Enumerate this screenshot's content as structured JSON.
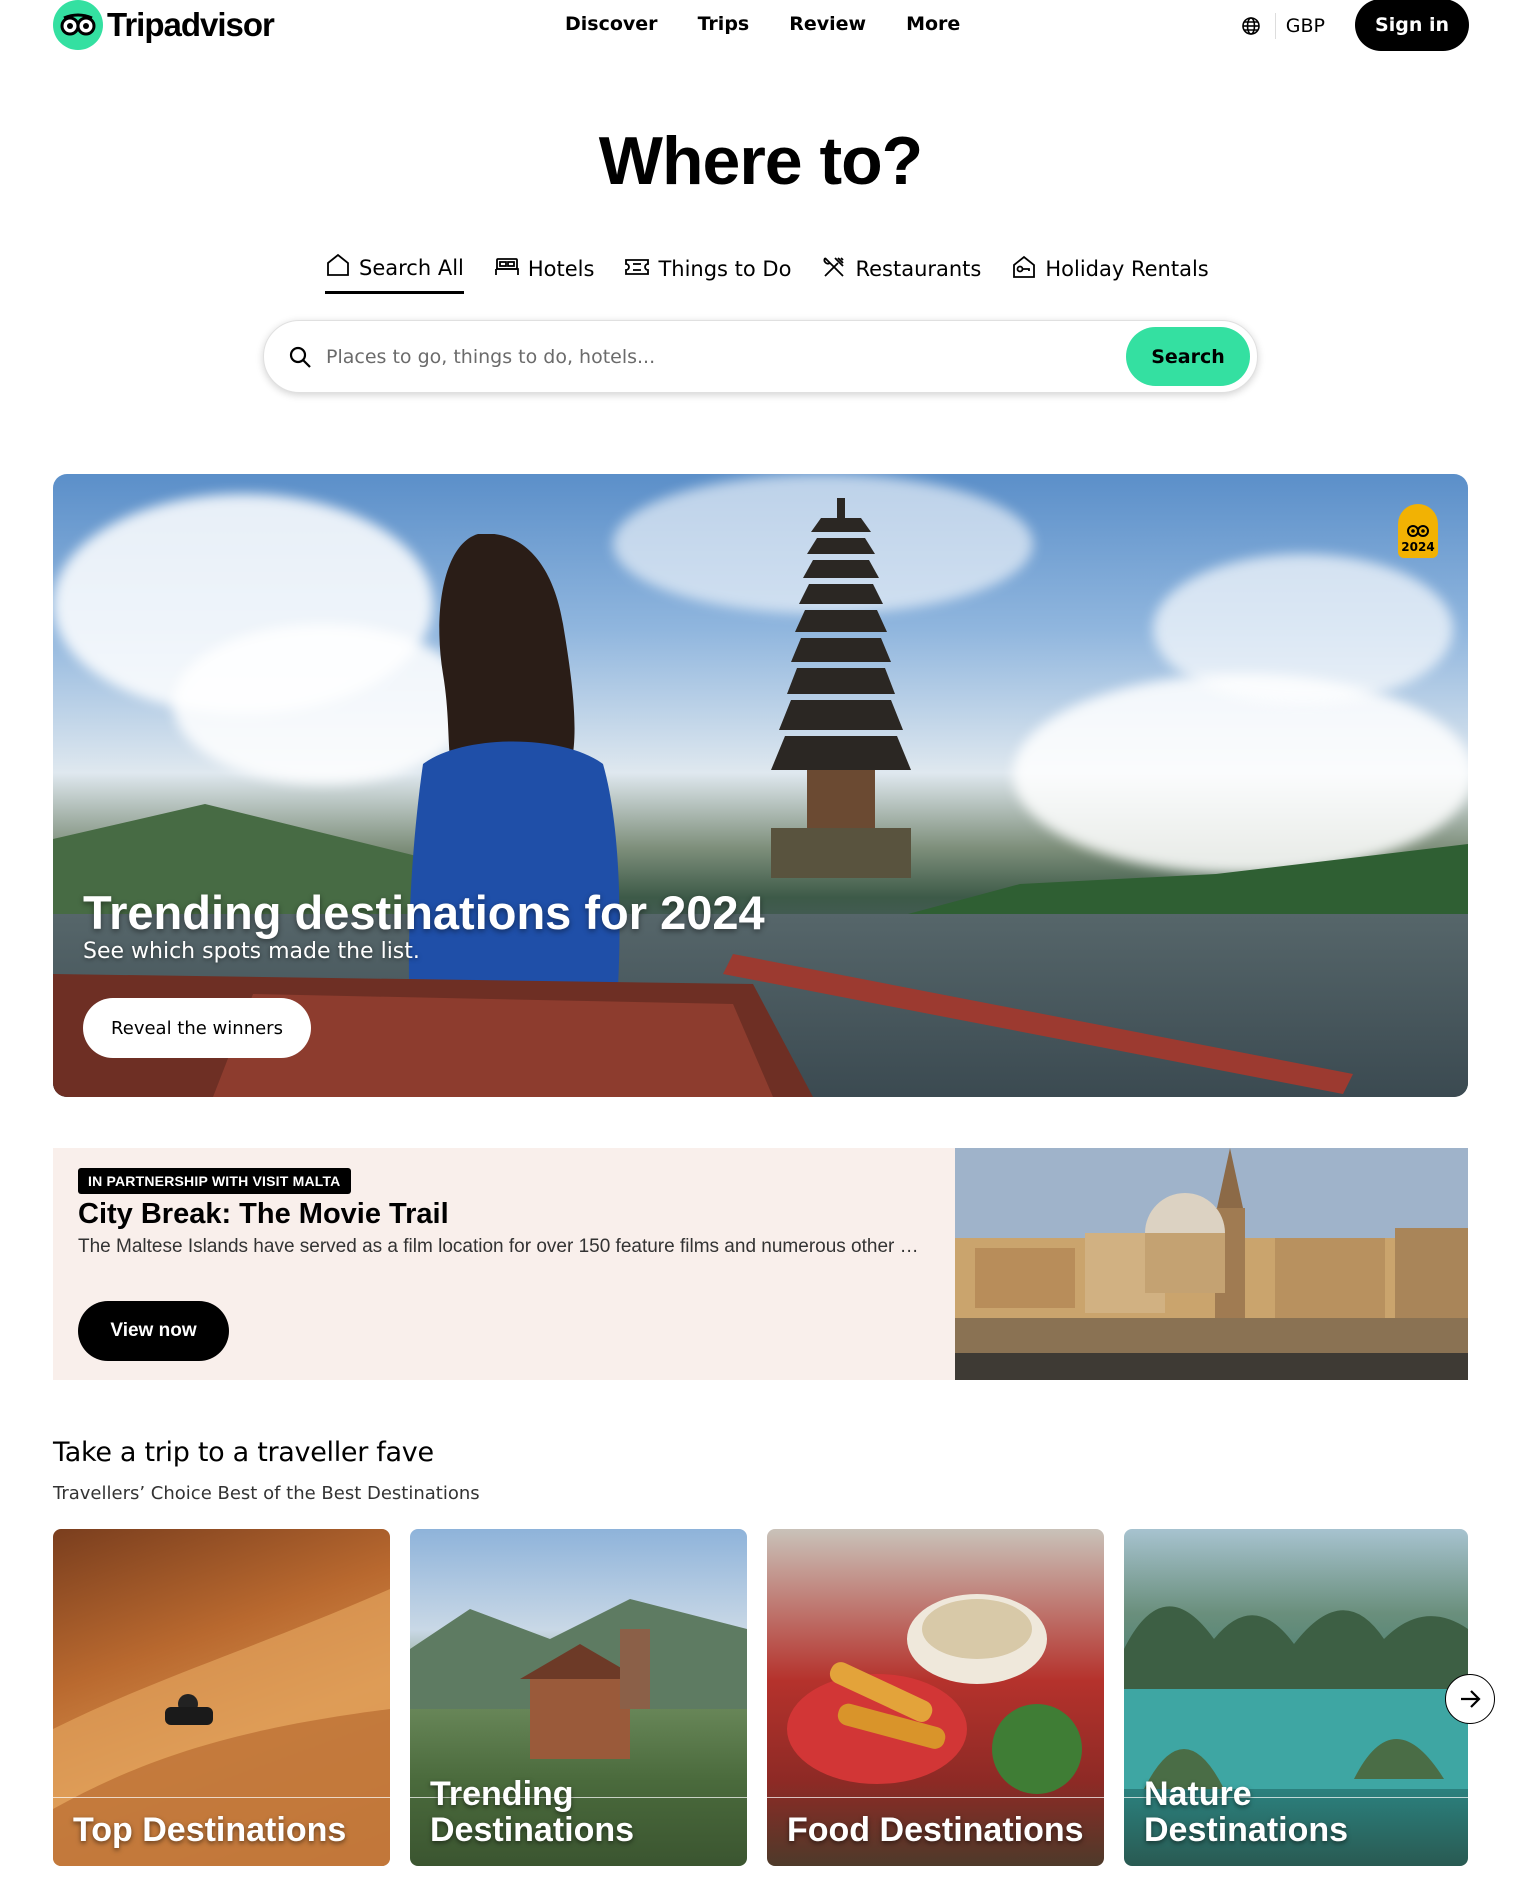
{
  "header": {
    "brand": "Tripadvisor",
    "nav": [
      "Discover",
      "Trips",
      "Review",
      "More"
    ],
    "currency": "GBP",
    "signin_label": "Sign in"
  },
  "hero_heading": "Where to?",
  "tabs": [
    {
      "label": "Search All",
      "icon": "home-icon",
      "active": true
    },
    {
      "label": "Hotels",
      "icon": "bed-icon",
      "active": false
    },
    {
      "label": "Things to Do",
      "icon": "ticket-icon",
      "active": false
    },
    {
      "label": "Restaurants",
      "icon": "utensils-icon",
      "active": false
    },
    {
      "label": "Holiday Rentals",
      "icon": "house-key-icon",
      "active": false
    }
  ],
  "search": {
    "placeholder": "Places to go, things to do, hotels...",
    "button_label": "Search"
  },
  "banner": {
    "title": "Trending destinations for 2024",
    "subtitle": "See which spots made the list.",
    "button_label": "Reveal the winners",
    "badge_year": "2024"
  },
  "partner": {
    "tag": "IN PARTNERSHIP WITH VISIT MALTA",
    "title": "City Break: The Movie Trail",
    "description": "The Maltese Islands have served as a film location for over 150 feature films and numerous other productions",
    "button_label": "View now"
  },
  "fave": {
    "title": "Take a trip to a traveller fave",
    "subtitle": "Travellers’ Choice Best of the Best Destinations",
    "cards": [
      {
        "label_line1": "",
        "label_line2": "Top Destinations"
      },
      {
        "label_line1": "Trending",
        "label_line2": "Destinations"
      },
      {
        "label_line1": "",
        "label_line2": "Food Destinations"
      },
      {
        "label_line1": "Nature",
        "label_line2": "Destinations"
      }
    ]
  },
  "colors": {
    "brand_green": "#34e0a1",
    "black": "#000000",
    "partner_bg": "#f9efeb",
    "award_gold": "#f2b203"
  }
}
